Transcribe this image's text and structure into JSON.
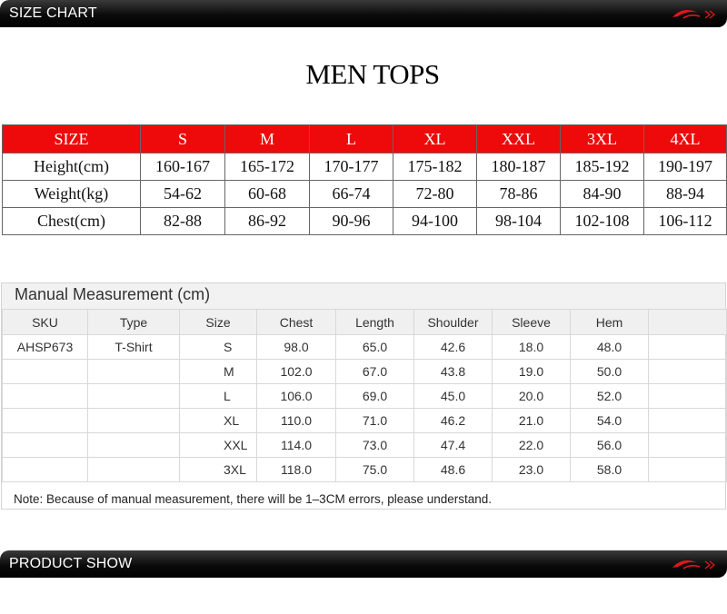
{
  "top_bar": {
    "title": "SIZE CHART"
  },
  "heading": "MEN TOPS",
  "size_chart": {
    "header": [
      "SIZE",
      "S",
      "M",
      "L",
      "XL",
      "XXL",
      "3XL",
      "4XL"
    ],
    "rows": [
      [
        "Height(cm)",
        "160-167",
        "165-172",
        "170-177",
        "175-182",
        "180-187",
        "185-192",
        "190-197"
      ],
      [
        "Weight(kg)",
        "54-62",
        "60-68",
        "66-74",
        "72-80",
        "78-86",
        "84-90",
        "88-94"
      ],
      [
        "Chest(cm)",
        "82-88",
        "86-92",
        "90-96",
        "94-100",
        "98-104",
        "102-108",
        "106-112"
      ]
    ]
  },
  "manual": {
    "title": "Manual Measurement (cm)",
    "header": [
      "SKU",
      "Type",
      "Size",
      "Chest",
      "Length",
      "Shoulder",
      "Sleeve",
      "Hem",
      ""
    ],
    "rows": [
      [
        "AHSP673",
        "T-Shirt",
        "S",
        "98.0",
        "65.0",
        "42.6",
        "18.0",
        "48.0",
        ""
      ],
      [
        "",
        "",
        "M",
        "102.0",
        "67.0",
        "43.8",
        "19.0",
        "50.0",
        ""
      ],
      [
        "",
        "",
        "L",
        "106.0",
        "69.0",
        "45.0",
        "20.0",
        "52.0",
        ""
      ],
      [
        "",
        "",
        "XL",
        "110.0",
        "71.0",
        "46.2",
        "21.0",
        "54.0",
        ""
      ],
      [
        "",
        "",
        "XXL",
        "114.0",
        "73.0",
        "47.4",
        "22.0",
        "56.0",
        ""
      ],
      [
        "",
        "",
        "3XL",
        "118.0",
        "75.0",
        "48.6",
        "23.0",
        "58.0",
        ""
      ]
    ],
    "note": "Note: Because of manual measurement, there will be 1–3CM errors, please understand."
  },
  "bottom_bar": {
    "title": "PRODUCT SHOW"
  },
  "icons": {
    "brand_logo": "li-ning-logo-icon"
  },
  "colors": {
    "header_red": "#ee0a0a",
    "bar_black": "#000000",
    "logo_red": "#e8141c"
  }
}
